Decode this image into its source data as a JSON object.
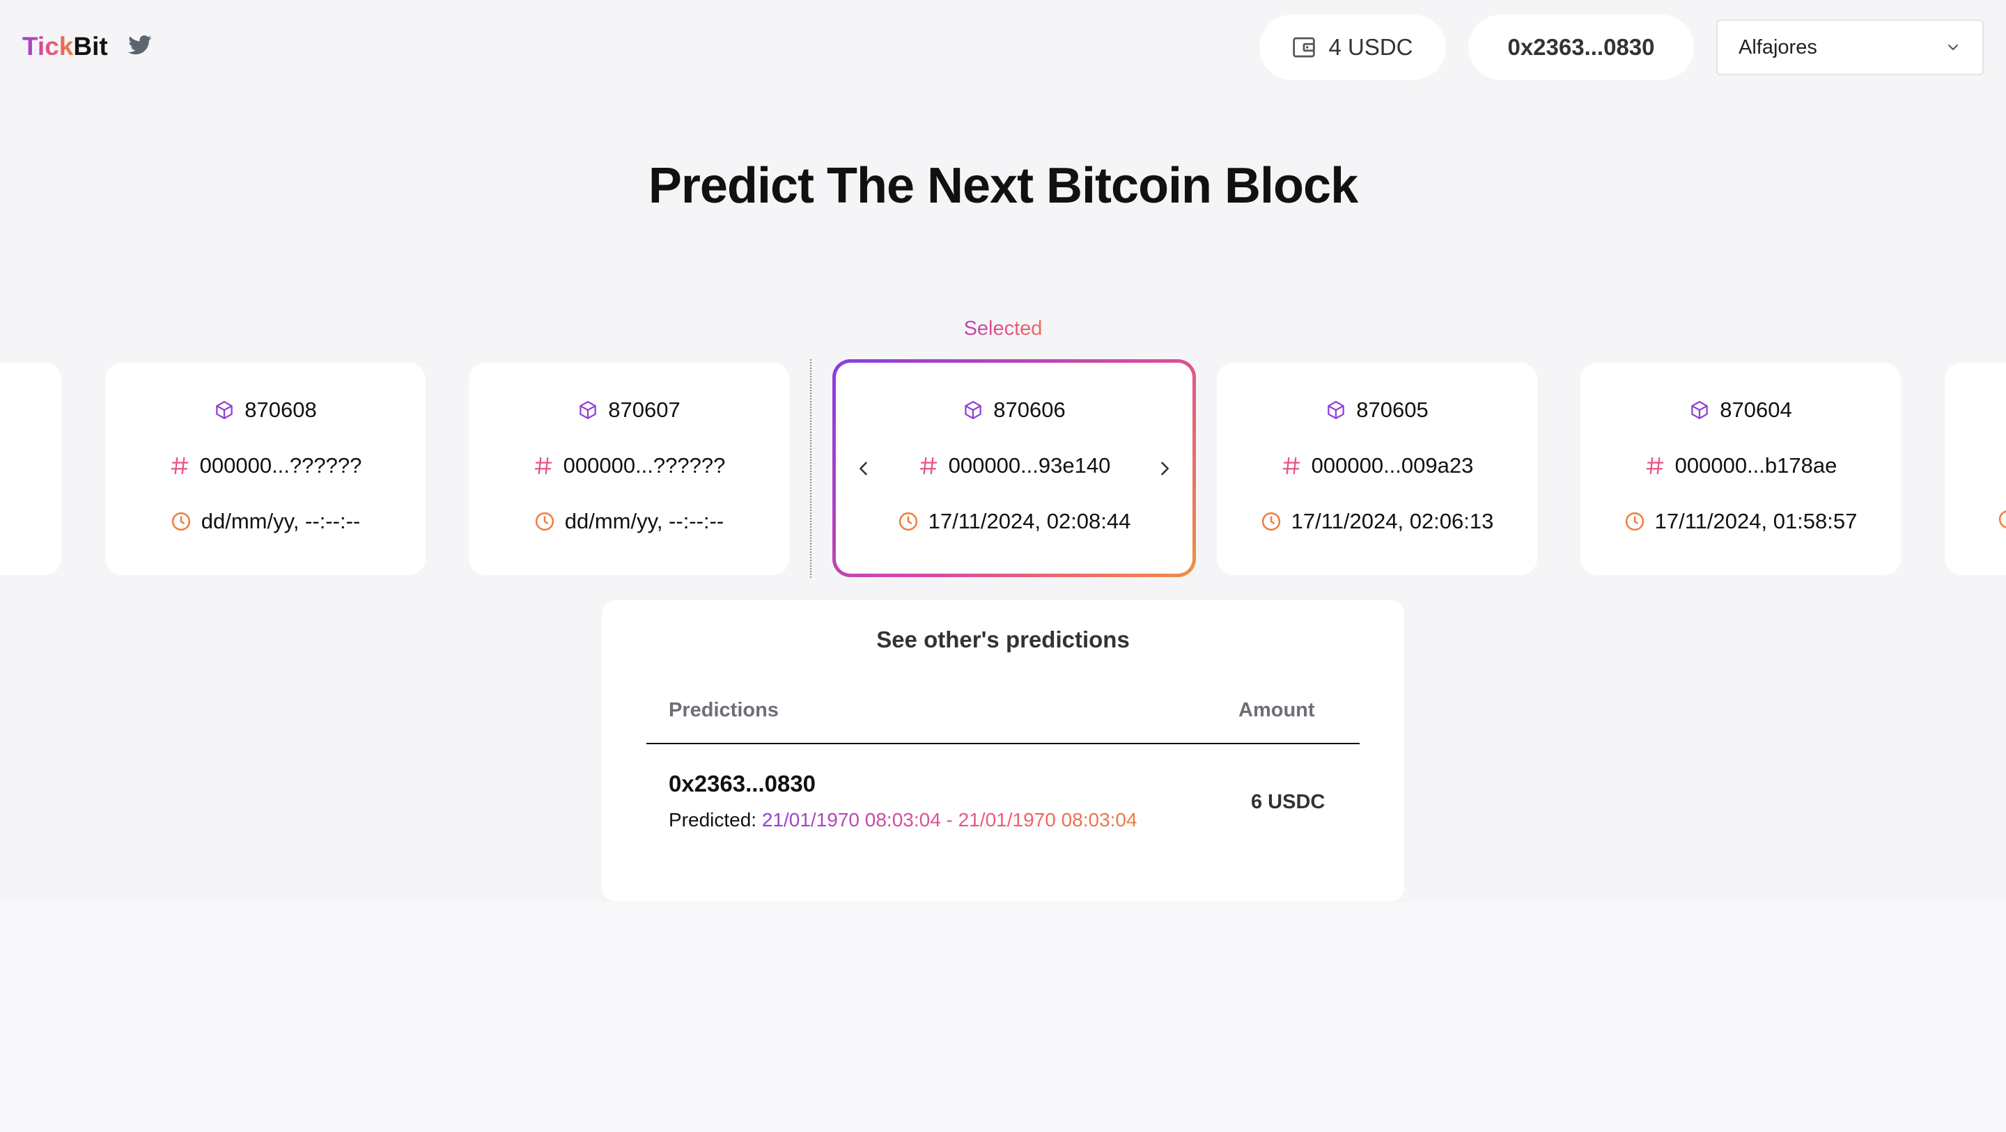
{
  "header": {
    "brand_part1": "Tick",
    "brand_part2": "Bit",
    "balance": "4 USDC",
    "address": "0x2363...0830",
    "network": "Alfajores"
  },
  "title": "Predict The Next Bitcoin Block",
  "selected_label": "Selected",
  "blocks": [
    {
      "number": "870608",
      "hash": "000000...??????",
      "time": "dd/mm/yy, --:--:--"
    },
    {
      "number": "870607",
      "hash": "000000...??????",
      "time": "dd/mm/yy, --:--:--"
    },
    {
      "number": "870606",
      "hash": "000000...93e140",
      "time": "17/11/2024, 02:08:44"
    },
    {
      "number": "870605",
      "hash": "000000...009a23",
      "time": "17/11/2024, 02:06:13"
    },
    {
      "number": "870604",
      "hash": "000000...b178ae",
      "time": "17/11/2024, 01:58:57"
    }
  ],
  "predictions": {
    "title": "See other's predictions",
    "col_predictions": "Predictions",
    "col_amount": "Amount",
    "rows": [
      {
        "address": "0x2363...0830",
        "predicted_label": "Predicted: ",
        "range": "21/01/1970 08:03:04 - 21/01/1970 08:03:04",
        "amount": "6 USDC"
      }
    ]
  },
  "colors": {
    "accent_purple": "#8f3fd6",
    "accent_pink": "#e9508a",
    "accent_orange": "#ef7c3a"
  },
  "icons": [
    "twitter-icon",
    "wallet-icon",
    "chevron-down-icon",
    "cube-icon",
    "hash-icon",
    "clock-icon",
    "chevron-left-icon",
    "chevron-right-icon"
  ]
}
